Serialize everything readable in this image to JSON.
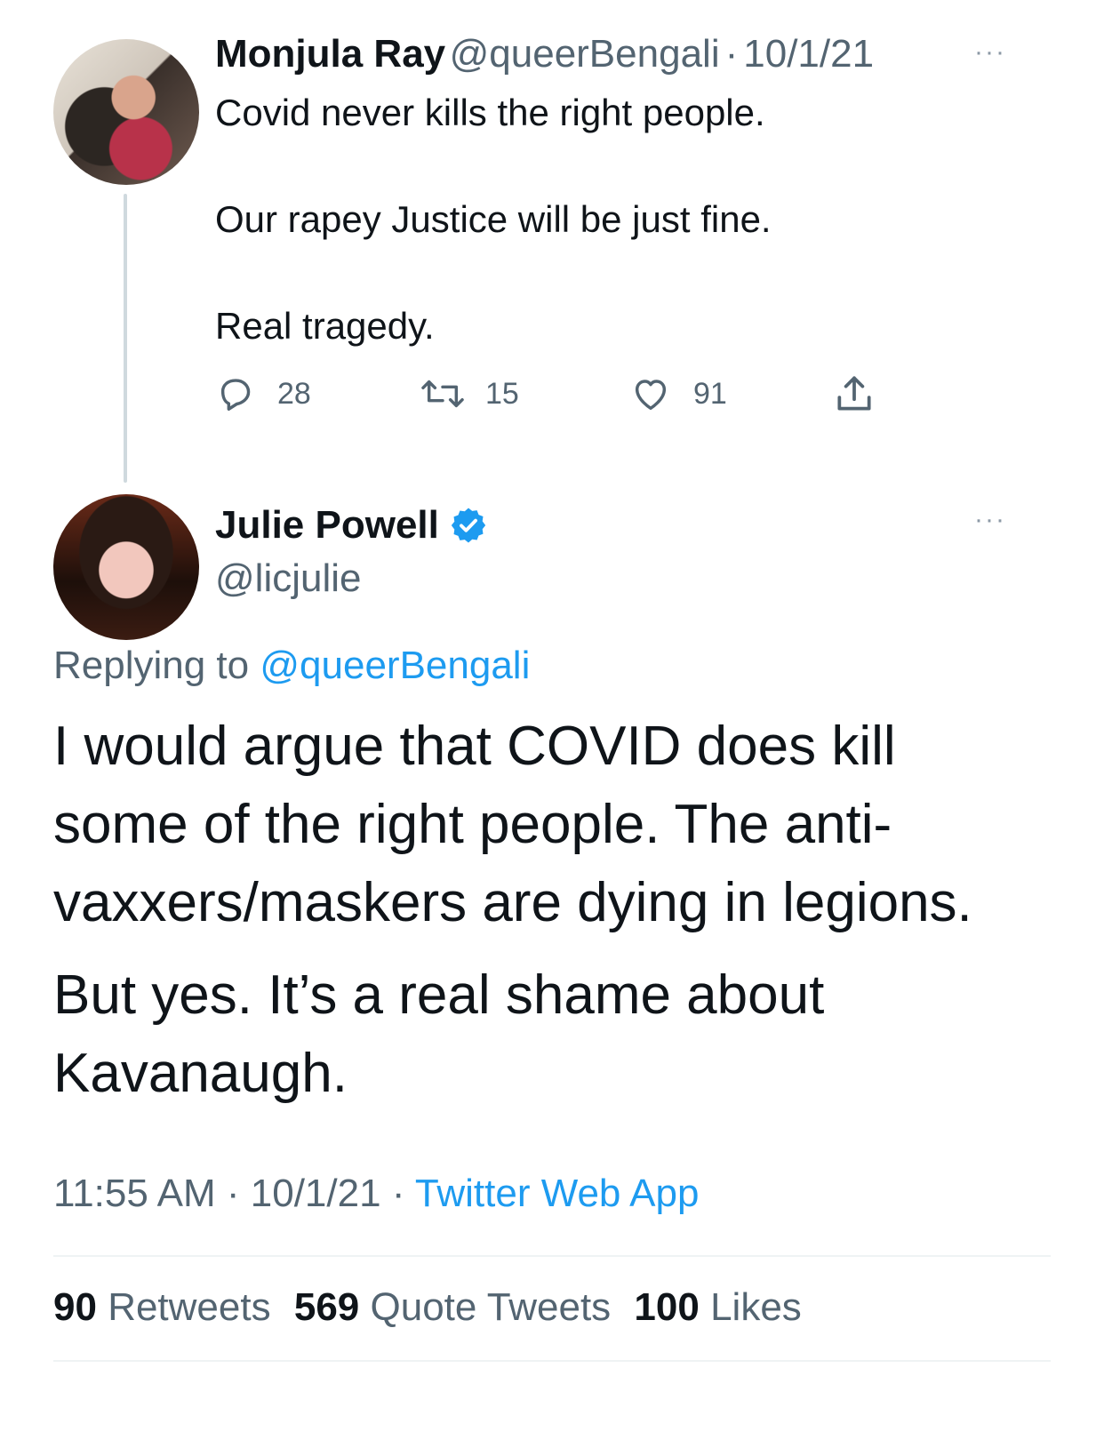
{
  "parent_tweet": {
    "name": "Monjula Ray",
    "handle": "@queerBengali",
    "separator": "·",
    "date": "10/1/21",
    "more": "···",
    "lines": [
      "Covid never kills the right people.",
      "Our rapey Justice will be just fine.",
      "Real tragedy."
    ],
    "actions": {
      "reply_count": "28",
      "retweet_count": "15",
      "like_count": "91"
    }
  },
  "main_tweet": {
    "name": "Julie Powell",
    "handle": "@licjulie",
    "more": "···",
    "replying_to_label": "Replying to",
    "replying_to_handle": "@queerBengali",
    "paragraph1_lines": [
      "I would argue that COVID does kill",
      "some of the right people. The anti-",
      "vaxxers/maskers are dying in legions."
    ],
    "paragraph2_lines": [
      "But yes. It’s a real shame about",
      "Kavanaugh."
    ],
    "time": "11:55 AM",
    "sep": "·",
    "date": "10/1/21",
    "source": "Twitter Web App",
    "stats": {
      "retweets_value": "90",
      "retweets_label": "Retweets",
      "quotes_value": "569",
      "quotes_label": "Quote Tweets",
      "likes_value": "100",
      "likes_label": "Likes"
    }
  },
  "colors": {
    "accent": "#1d9bf0",
    "text": "#0f1419",
    "secondary": "#536471",
    "verified": "#1d9bf0"
  }
}
